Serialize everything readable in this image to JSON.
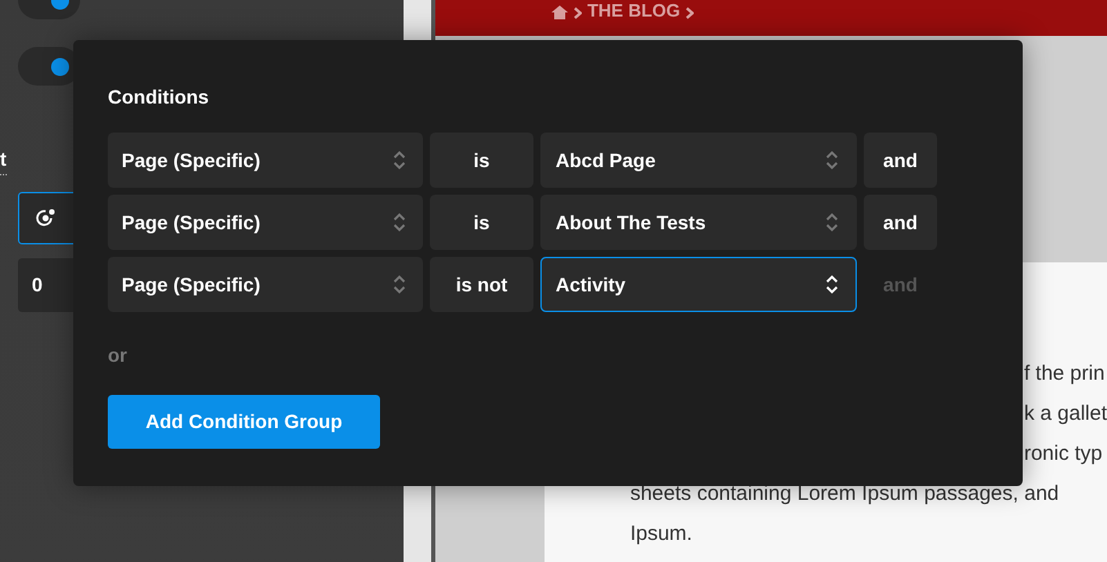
{
  "sidebar": {
    "toggles": [
      {
        "on": true
      },
      {
        "on": true
      }
    ],
    "label": "t",
    "number_field": {
      "value": "0"
    }
  },
  "page": {
    "breadcrumb": [
      "THE BLOG"
    ],
    "partial_lines": [
      "f the prin",
      "k a gallet",
      "ronic typ"
    ],
    "full_lines": [
      "sheets containing Lorem Ipsum passages, and",
      "Ipsum."
    ]
  },
  "dialog": {
    "title": "Conditions",
    "rows": [
      {
        "field": "Page (Specific)",
        "operator": "is",
        "value": "Abcd Page",
        "focused": false,
        "connector": {
          "label": "and",
          "disabled": false
        }
      },
      {
        "field": "Page (Specific)",
        "operator": "is",
        "value": "About The Tests",
        "focused": false,
        "connector": {
          "label": "and",
          "disabled": false
        }
      },
      {
        "field": "Page (Specific)",
        "operator": "is not",
        "value": "Activity",
        "focused": true,
        "connector": {
          "label": "and",
          "disabled": true
        }
      }
    ],
    "or_label": "or",
    "add_button": "Add Condition Group"
  }
}
